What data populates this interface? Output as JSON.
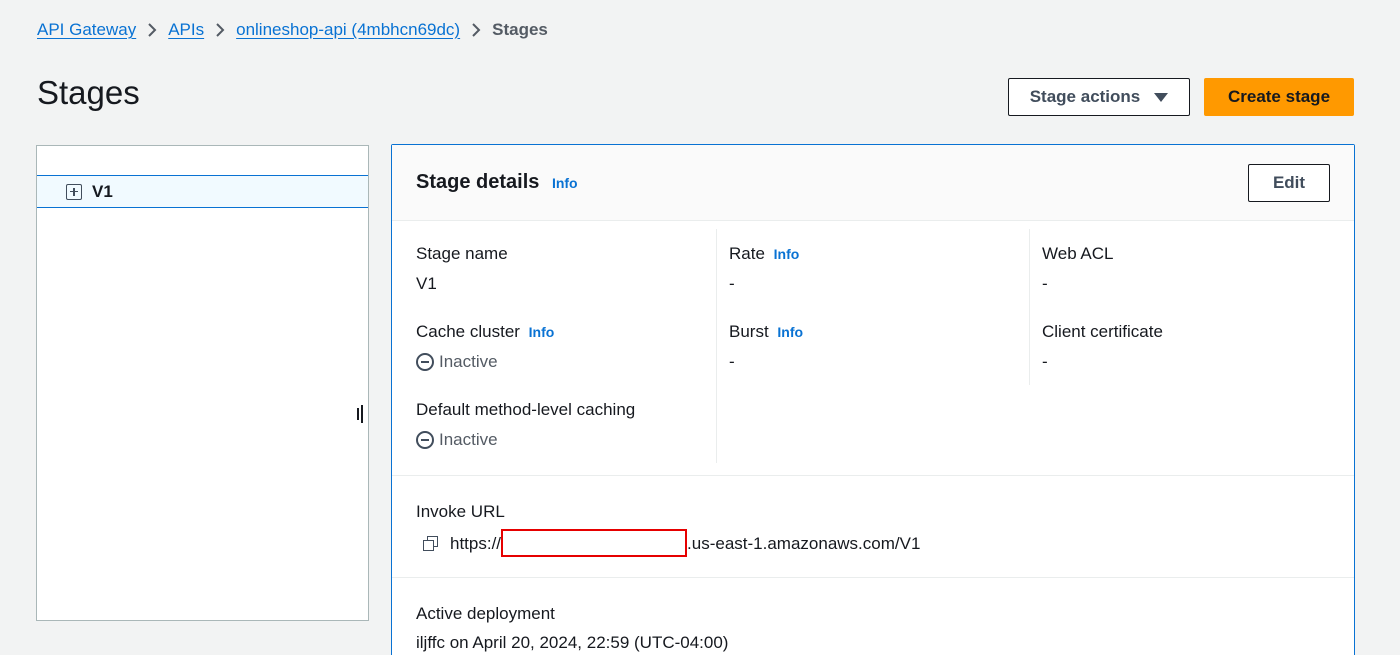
{
  "breadcrumb": {
    "items": [
      "API Gateway",
      "APIs",
      "onlineshop-api (4mbhcn69dc)"
    ],
    "current": "Stages"
  },
  "header": {
    "title": "Stages",
    "stage_actions_label": "Stage actions",
    "create_stage_label": "Create stage"
  },
  "tree": {
    "items": [
      {
        "label": "V1"
      }
    ]
  },
  "details": {
    "title": "Stage details",
    "info_label": "Info",
    "edit_label": "Edit",
    "stage_name": {
      "label": "Stage name",
      "value": "V1"
    },
    "rate": {
      "label": "Rate",
      "info": "Info",
      "value": "-"
    },
    "web_acl": {
      "label": "Web ACL",
      "value": "-"
    },
    "cache_cluster": {
      "label": "Cache cluster",
      "info": "Info",
      "value": "Inactive"
    },
    "burst": {
      "label": "Burst",
      "info": "Info",
      "value": "-"
    },
    "client_certificate": {
      "label": "Client certificate",
      "value": "-"
    },
    "default_caching": {
      "label": "Default method-level caching",
      "value": "Inactive"
    },
    "invoke_url": {
      "label": "Invoke URL",
      "prefix": "https://",
      "suffix": ".us-east-1.amazonaws.com/V1"
    },
    "active_deployment": {
      "label": "Active deployment",
      "value": "iljffc on April 20, 2024, 22:59 (UTC-04:00)"
    }
  },
  "colors": {
    "link": "#0972d3",
    "primary_button": "#ff9900",
    "redaction": "#e60000",
    "background": "#f2f3f3"
  }
}
